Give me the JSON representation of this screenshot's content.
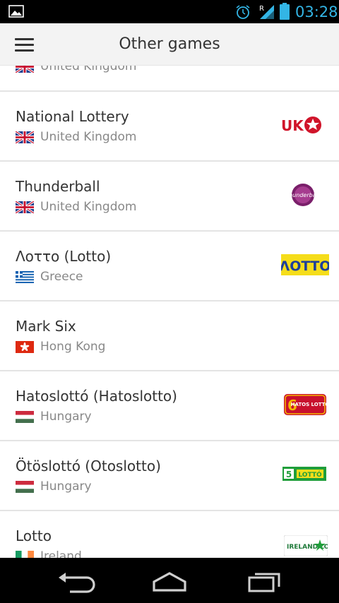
{
  "status_bar": {
    "time": "03:28",
    "icons": [
      "picture-icon",
      "alarm-icon",
      "signal-roaming-icon",
      "battery-icon"
    ],
    "roaming_label": "R",
    "accent": "#33b5e5"
  },
  "action_bar": {
    "title": "Other games",
    "menu_icon": "hamburger-menu-icon"
  },
  "list": {
    "partial_top": {
      "country": "United Kingdom",
      "flag": "uk-flag-icon"
    },
    "items": [
      {
        "name": "National Lottery",
        "country": "United Kingdom",
        "flag": "uk-flag-icon",
        "logo": "uk-lotto-logo",
        "logo_text": "UK"
      },
      {
        "name": "Thunderball",
        "country": "United Kingdom",
        "flag": "uk-flag-icon",
        "logo": "thunderball-logo",
        "logo_text": "thunderball"
      },
      {
        "name": "Λοττο (Lotto)",
        "country": "Greece",
        "flag": "greece-flag-icon",
        "logo": "greek-lotto-logo",
        "logo_text": "ΛΟΤΤΟ"
      },
      {
        "name": "Mark Six",
        "country": "Hong Kong",
        "flag": "hong-kong-flag-icon",
        "logo": "",
        "logo_text": ""
      },
      {
        "name": "Hatoslottó (Hatoslotto)",
        "country": "Hungary",
        "flag": "hungary-flag-icon",
        "logo": "hatoslotto-logo",
        "logo_text": "HATOS LOTTÓ"
      },
      {
        "name": "Ötöslottó (Otoslotto)",
        "country": "Hungary",
        "flag": "hungary-flag-icon",
        "logo": "otoslotto-logo",
        "logo_text": "LOTTÓ"
      },
      {
        "name": "Lotto",
        "country": "Ireland",
        "flag": "ireland-flag-icon",
        "logo": "ireland-lotto-logo",
        "logo_text": "IRELAND LOTTO"
      }
    ]
  },
  "nav_bar": {
    "buttons": [
      "back-icon",
      "home-icon",
      "recent-apps-icon"
    ]
  }
}
